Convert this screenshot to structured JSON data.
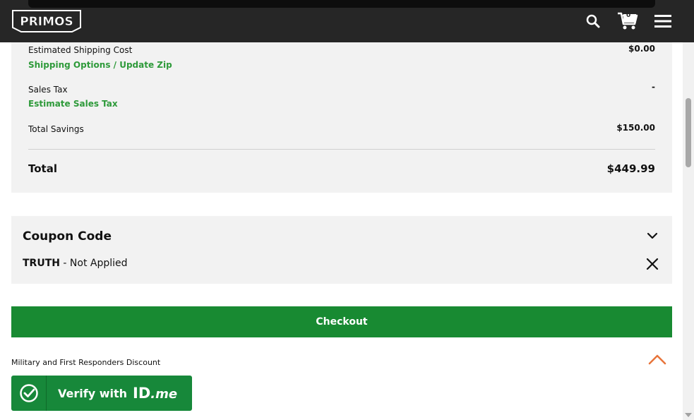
{
  "header": {
    "logo_text": "PRIMOS",
    "cart_count": "0",
    "icons": [
      "search-icon",
      "cart-icon",
      "menu-icon"
    ]
  },
  "summary": {
    "shipping_label": "Estimated Shipping Cost",
    "shipping_value": "$0.00",
    "shipping_link": "Shipping Options / Update Zip",
    "tax_label": "Sales Tax",
    "tax_value": "-",
    "tax_link": "Estimate Sales Tax",
    "savings_label": "Total Savings",
    "savings_value": "$150.00",
    "total_label": "Total",
    "total_value": "$449.99"
  },
  "coupon": {
    "title": "Coupon Code",
    "code": "TRUTH",
    "status": " - Not Applied",
    "toggle_icon": "chevron-down-icon",
    "remove_icon": "close-icon"
  },
  "checkout": {
    "label": "Checkout"
  },
  "military": {
    "label": "Military and First Responders Discount",
    "verify_text": "Verify with",
    "verify_brand_id": "ID",
    "verify_brand_me": ".me"
  },
  "colors": {
    "accent_green": "#188a32",
    "link_green": "#2e9a3a",
    "header_bg": "#262626",
    "back_to_top": "#e8743b"
  }
}
